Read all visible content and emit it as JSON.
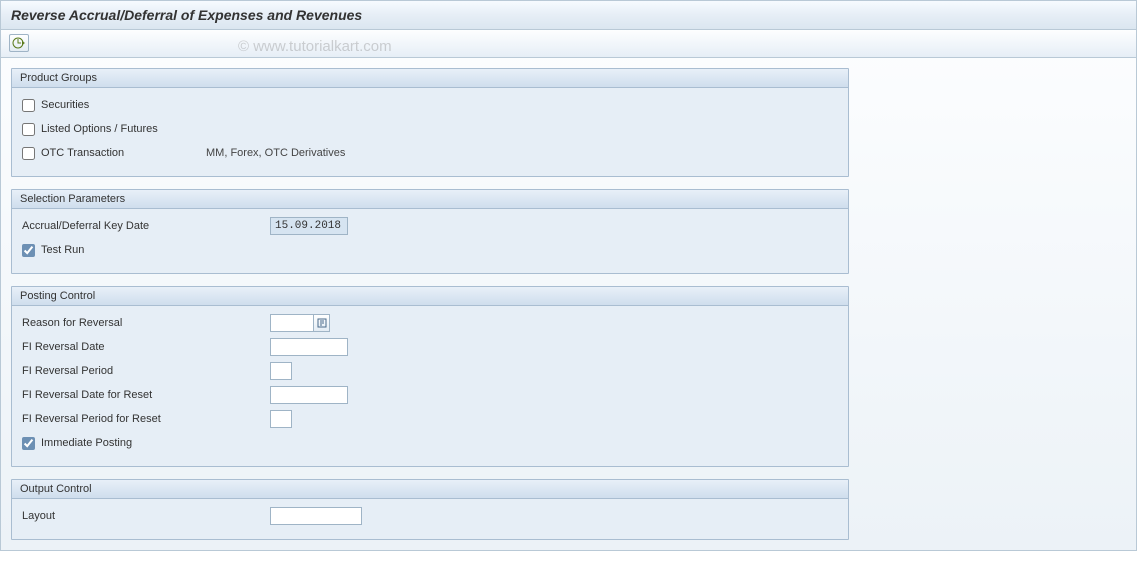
{
  "title": "Reverse Accrual/Deferral of Expenses and Revenues",
  "watermark": "© www.tutorialkart.com",
  "groups": {
    "product": {
      "title": "Product Groups",
      "securities": {
        "label": "Securities",
        "checked": false
      },
      "listed": {
        "label": "Listed Options / Futures",
        "checked": false
      },
      "otc": {
        "label": "OTC Transaction",
        "checked": false,
        "desc": "MM, Forex, OTC Derivatives"
      }
    },
    "selection": {
      "title": "Selection Parameters",
      "keydate": {
        "label": "Accrual/Deferral Key Date",
        "value": "15.09.2018"
      },
      "testrun": {
        "label": "Test Run",
        "checked": true
      }
    },
    "posting": {
      "title": "Posting Control",
      "reason": {
        "label": "Reason for Reversal",
        "value": ""
      },
      "fi_date": {
        "label": "FI Reversal Date",
        "value": ""
      },
      "fi_period": {
        "label": "FI Reversal Period",
        "value": ""
      },
      "fi_date_reset": {
        "label": "FI Reversal Date for Reset",
        "value": ""
      },
      "fi_period_reset": {
        "label": "FI Reversal Period for Reset",
        "value": ""
      },
      "immediate": {
        "label": "Immediate Posting",
        "checked": true
      }
    },
    "output": {
      "title": "Output Control",
      "layout": {
        "label": "Layout",
        "value": ""
      }
    }
  }
}
